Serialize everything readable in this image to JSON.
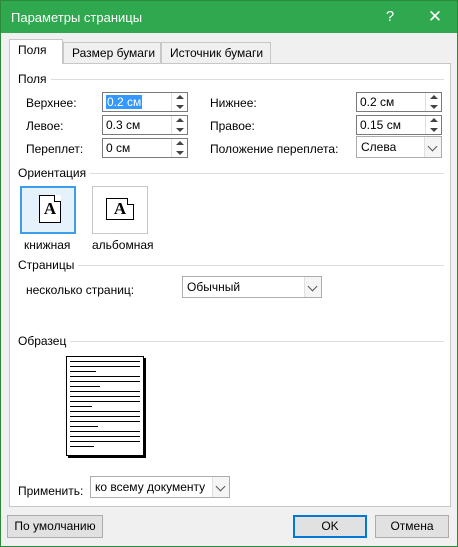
{
  "window": {
    "title": "Параметры страницы",
    "help": "?",
    "close": "✕"
  },
  "tabs": [
    "Поля",
    "Размер бумаги",
    "Источник бумаги"
  ],
  "margins": {
    "group": "Поля",
    "top_label": "Верхнее:",
    "top_value": "0.2 см",
    "bottom_label": "Нижнее:",
    "bottom_value": "0.2 см",
    "left_label": "Левое:",
    "left_value": "0.3 см",
    "right_label": "Правое:",
    "right_value": "0.15 см",
    "gutter_label": "Переплет:",
    "gutter_value": "0 см",
    "gutter_pos_label": "Положение переплета:",
    "gutter_pos_value": "Слева"
  },
  "orientation": {
    "group": "Ориентация",
    "portrait_label": "книжная",
    "landscape_label": "альбомная",
    "glyph": "A",
    "selected": "portrait"
  },
  "pages": {
    "group": "Страницы",
    "multiple_label": "несколько страниц:",
    "multiple_value": "Обычный"
  },
  "preview": {
    "group": "Образец"
  },
  "apply": {
    "label": "Применить:",
    "value": "ко всему документу"
  },
  "buttons": {
    "default": "По умолчанию",
    "ok": "OK",
    "cancel": "Отмена"
  },
  "colors": {
    "titlebar": "#2fa84f",
    "selection": "#3399ff",
    "focus": "#0078d7"
  }
}
